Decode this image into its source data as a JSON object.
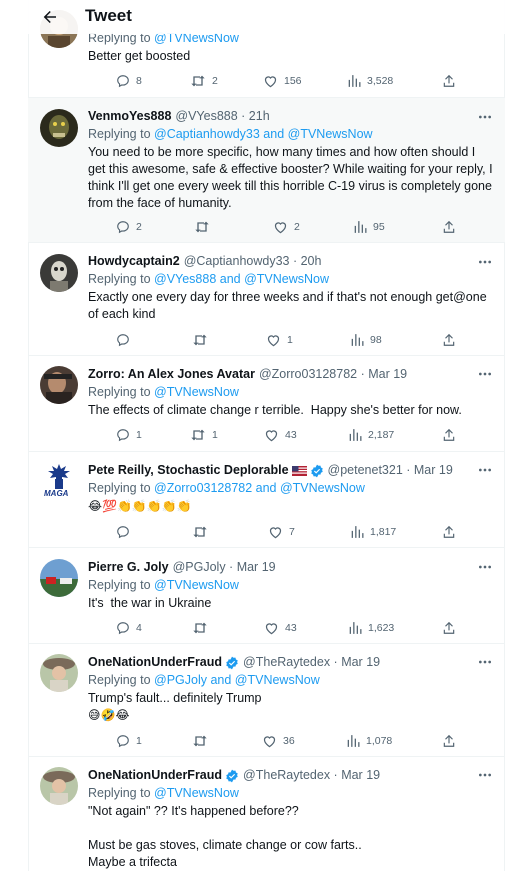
{
  "header": {
    "title": "Tweet"
  },
  "partial": {
    "replying_prefix": "Replying to ",
    "replying_to": "@TVNewsNow",
    "text": "Better get boosted",
    "replies": "8",
    "retweets": "2",
    "likes": "156",
    "views": "3,528"
  },
  "tweets": [
    {
      "name": "VenmoYes888",
      "handle": "@VYes888 · 21h",
      "replying_prefix": "Replying to ",
      "replying_to": "@Captianhowdy33 and @TVNewsNow",
      "text": "You need to be more specific, how many times and how often should I get this awesome, safe & effective booster? While waiting for your reply, I think I'll get one every week till this horrible C-19 virus is completely gone from the face of humanity.",
      "replies": "2",
      "retweets": "",
      "likes": "2",
      "views": "95"
    },
    {
      "name": "Howdycaptain2",
      "handle": "@Captianhowdy33 · 20h",
      "replying_prefix": "Replying to ",
      "replying_to": "@VYes888 and @TVNewsNow",
      "text": "Exactly one every day for three weeks and if that's not enough get@one of each kind",
      "replies": "",
      "retweets": "",
      "likes": "1",
      "views": "98"
    },
    {
      "name": "Zorro: An Alex Jones Avatar",
      "handle": "@Zorro03128782 · Mar 19",
      "replying_prefix": "Replying to ",
      "replying_to": "@TVNewsNow",
      "text": "The effects of climate change r terrible.  Happy she's better for now.",
      "replies": "1",
      "retweets": "1",
      "likes": "43",
      "views": "2,187"
    },
    {
      "name": "Pete Reilly, Stochastic Deplorable",
      "handle": "@petenet321 · Mar 19",
      "replying_prefix": "Replying to ",
      "replying_to": "@Zorro03128782 and @TVNewsNow",
      "text": "😂💯👏👏👏👏👏",
      "replies": "",
      "retweets": "",
      "likes": "7",
      "views": "1,817"
    },
    {
      "name": "Pierre G. Joly",
      "handle": "@PGJoly · Mar 19",
      "replying_prefix": "Replying to ",
      "replying_to": "@TVNewsNow",
      "text": "It's  the war in Ukraine",
      "replies": "4",
      "retweets": "",
      "likes": "43",
      "views": "1,623"
    },
    {
      "name": "OneNationUnderFraud",
      "handle": "@TheRaytedex · Mar 19",
      "replying_prefix": "Replying to ",
      "replying_to": "@PGJoly and @TVNewsNow",
      "text": "Trump's fault... definitely Trump",
      "text2": "😅🤣😂",
      "replies": "1",
      "retweets": "",
      "likes": "36",
      "views": "1,078"
    },
    {
      "name": "OneNationUnderFraud",
      "handle": "@TheRaytedex · Mar 19",
      "replying_prefix": "Replying to ",
      "replying_to": "@TVNewsNow",
      "text": "\"Not again\" ?? It's happened before??\n\nMust be gas stoves, climate change or cow farts..\nMaybe a trifecta",
      "replies": "",
      "retweets": "",
      "likes": "",
      "views": ""
    }
  ],
  "pete_logo_text": "MAGA",
  "colors": {
    "link": "#1d9bf0",
    "muted": "#536471",
    "verified": "#1d9bf0",
    "border": "#eff3f4"
  }
}
